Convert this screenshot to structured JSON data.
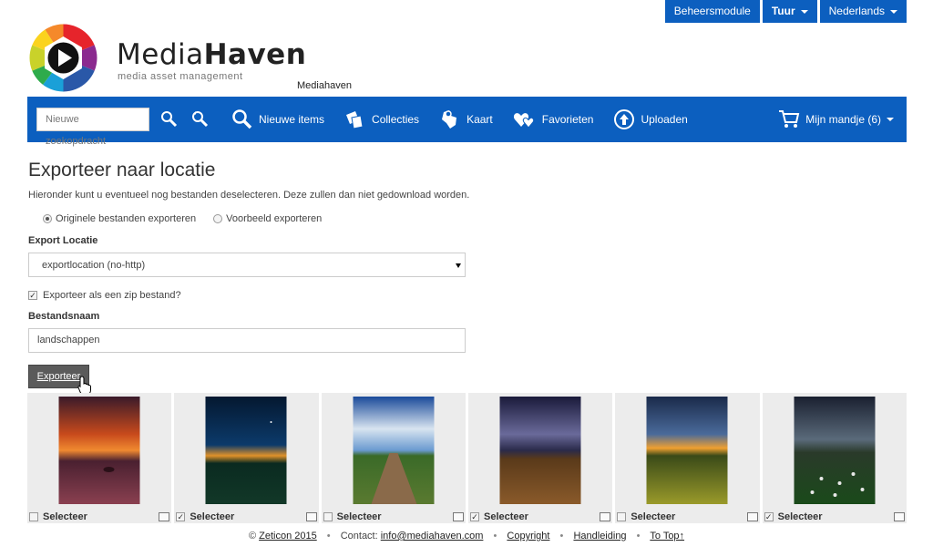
{
  "topmenu": {
    "admin": "Beheersmodule",
    "user": "Tuur",
    "language": "Nederlands"
  },
  "brand": {
    "name_light": "Media",
    "name_bold": "Haven",
    "tagline": "media asset management",
    "site": "Mediahaven"
  },
  "nav": {
    "search_placeholder": "Nieuwe zoekopdracht",
    "items": [
      {
        "label": "Nieuwe items",
        "icon": "search-icon"
      },
      {
        "label": "Collecties",
        "icon": "collections-icon"
      },
      {
        "label": "Kaart",
        "icon": "map-icon"
      },
      {
        "label": "Favorieten",
        "icon": "hearts-icon"
      },
      {
        "label": "Uploaden",
        "icon": "upload-icon"
      }
    ],
    "cart": "Mijn mandje (6)"
  },
  "page": {
    "title": "Exporteer naar locatie",
    "subtitle": "Hieronder kunt u eventueel nog bestanden deselecteren. Deze zullen dan niet gedownload worden.",
    "radio_original": "Originele bestanden exporteren",
    "radio_preview": "Voorbeeld exporteren",
    "export_location_label": "Export Locatie",
    "export_location_value": "exportlocation (no-http)",
    "zip_label": "Exporteer als een zip bestand?",
    "filename_label": "Bestandsnaam",
    "filename_value": "landschappen",
    "export_button": "Exporteer"
  },
  "gallery": [
    {
      "label": "Selecteer",
      "checked": false,
      "subject": "sunset over water"
    },
    {
      "label": "Selecteer",
      "checked": true,
      "subject": "night sky over field"
    },
    {
      "label": "Selecteer",
      "checked": false,
      "subject": "dirt road under blue sky"
    },
    {
      "label": "Selecteer",
      "checked": true,
      "subject": "stormy clouds over field"
    },
    {
      "label": "Selecteer",
      "checked": false,
      "subject": "golden field at dusk"
    },
    {
      "label": "Selecteer",
      "checked": true,
      "subject": "flower meadow under dark clouds"
    }
  ],
  "footer": {
    "copyright": "© ",
    "company": "Zeticon 2015",
    "contact_prefix": "Contact: ",
    "email": "info@mediahaven.com",
    "copyright_link": "Copyright",
    "manual": "Handleiding",
    "totop": "To Top↑"
  },
  "colors": {
    "brand_blue": "#0c5fbf",
    "button_gray": "#5b5b5b",
    "tile_bg": "#ececec"
  }
}
